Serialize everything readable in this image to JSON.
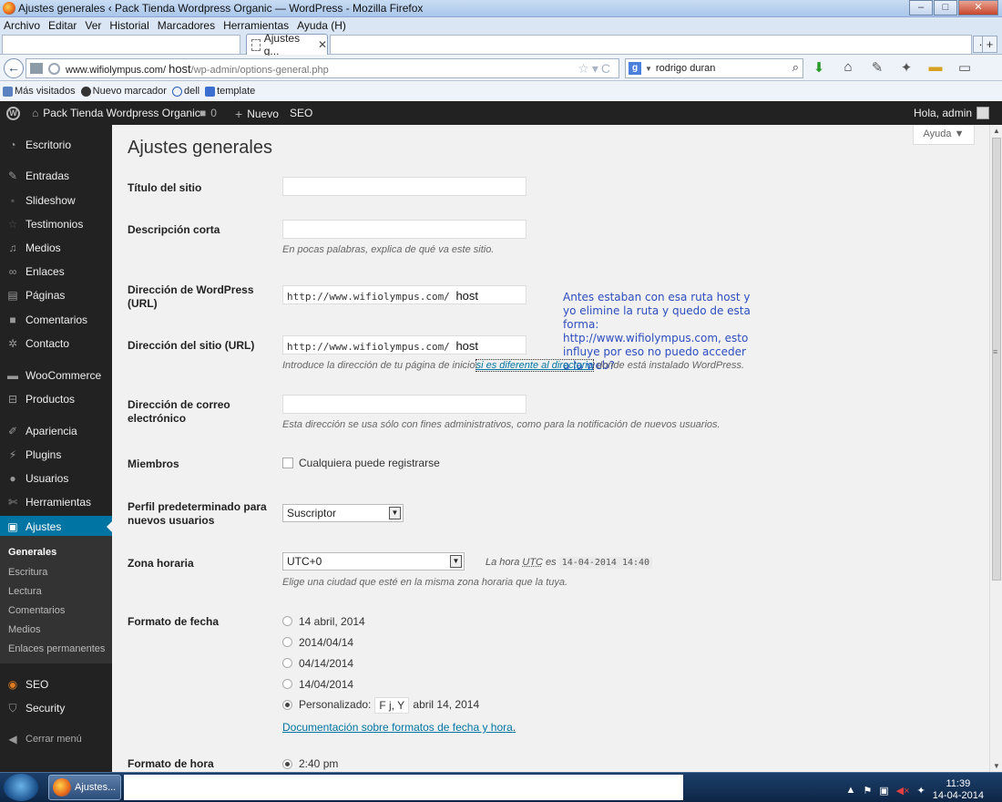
{
  "browser": {
    "window_title": "Ajustes generales ‹ Pack Tienda Wordpress Organic — WordPress - Mozilla Firefox",
    "menu": [
      "Archivo",
      "Editar",
      "Ver",
      "Historial",
      "Marcadores",
      "Herramientas",
      "Ayuda (H)"
    ],
    "tab_label": "Ajustes g...",
    "url_domain": "www.wifiolympus.com/",
    "url_host": "host",
    "url_path": "/wp-admin/options-general.php",
    "search_value": "rodrigo duran",
    "bookmarks": [
      "Más visitados",
      "Nuevo marcador",
      "dell",
      "template"
    ]
  },
  "adminbar": {
    "site_name": "Pack Tienda Wordpress Organic",
    "comments_count": "0",
    "new_label": "Nuevo",
    "seo_label": "SEO",
    "greeting": "Hola, admin"
  },
  "sidebar": {
    "items": [
      {
        "label": "Escritorio",
        "icon": "dashboard-icon"
      },
      {
        "label": "Entradas",
        "icon": "pin-icon"
      },
      {
        "label": "Slideshow",
        "icon": "slideshow-icon"
      },
      {
        "label": "Testimonios",
        "icon": "star-icon"
      },
      {
        "label": "Medios",
        "icon": "media-icon"
      },
      {
        "label": "Enlaces",
        "icon": "link-icon"
      },
      {
        "label": "Páginas",
        "icon": "pages-icon"
      },
      {
        "label": "Comentarios",
        "icon": "comment-icon"
      },
      {
        "label": "Contacto",
        "icon": "gear-icon"
      },
      {
        "label": "WooCommerce",
        "icon": "woocommerce-icon"
      },
      {
        "label": "Productos",
        "icon": "cart-icon"
      },
      {
        "label": "Apariencia",
        "icon": "brush-icon"
      },
      {
        "label": "Plugins",
        "icon": "plug-icon"
      },
      {
        "label": "Usuarios",
        "icon": "user-icon"
      },
      {
        "label": "Herramientas",
        "icon": "wrench-icon"
      },
      {
        "label": "Ajustes",
        "icon": "settings-icon"
      }
    ],
    "submenu": [
      "Generales",
      "Escritura",
      "Lectura",
      "Comentarios",
      "Medios",
      "Enlaces permanentes"
    ],
    "extra": [
      {
        "label": "SEO",
        "icon": "seo-icon"
      },
      {
        "label": "Security",
        "icon": "shield-icon"
      }
    ],
    "collapse_label": "Cerrar menú"
  },
  "page": {
    "title": "Ajustes generales",
    "help_label": "Ayuda ▼",
    "site_title_label": "Título del sitio",
    "site_title_value": "",
    "tagline_label": "Descripción corta",
    "tagline_value": "",
    "tagline_hint": "En pocas palabras, explica de qué va este sitio.",
    "wp_url_label": "Dirección de WordPress (URL)",
    "wp_url_prefix": "http://www.wifiolympus.com/",
    "wp_url_host": "host",
    "site_url_label": "Dirección del sitio (URL)",
    "site_url_prefix": "http://www.wifiolympus.com/",
    "site_url_host": "host",
    "site_url_hint_before": "Introduce la dirección de tu página de inicio",
    "site_url_hint_link": "si es diferente al directorio",
    "site_url_hint_after": "donde está instalado WordPress.",
    "annotation": "Antes estaban con esa ruta host  y yo elimine la ruta y quedo de esta forma: http://www.wifiolympus.com, esto influye por eso no puedo acceder a la web?",
    "email_label": "Dirección de correo electrónico",
    "email_value": "",
    "email_hint": "Esta dirección se usa sólo con fines administrativos, como para la notificación de nuevos usuarios.",
    "members_label": "Miembros",
    "members_checkbox": "Cualquiera puede registrarse",
    "role_label": "Perfil predeterminado para nuevos usuarios",
    "role_value": "Suscriptor",
    "timezone_label": "Zona horaria",
    "timezone_value": "UTC+0",
    "timezone_now_prefix": "La hora",
    "timezone_now_utc": "UTC",
    "timezone_now_es": "es",
    "timezone_now_value": "14-04-2014 14:40",
    "timezone_hint": "Elige una ciudad que esté en la misma zona horaria que la tuya.",
    "date_format_label": "Formato de fecha",
    "date_options": [
      "14 abril, 2014",
      "2014/04/14",
      "04/14/2014",
      "14/04/2014"
    ],
    "date_custom_label": "Personalizado:",
    "date_custom_value": "F j, Y",
    "date_custom_preview": "abril 14, 2014",
    "date_doc_link": "Documentación sobre formatos de fecha y hora",
    "date_doc_link_suffix": ".",
    "time_format_label": "Formato de hora",
    "time_first_option": "2:40 pm"
  },
  "taskbar": {
    "task_label": "Ajustes...",
    "time": "11:39",
    "date": "14-04-2014"
  }
}
